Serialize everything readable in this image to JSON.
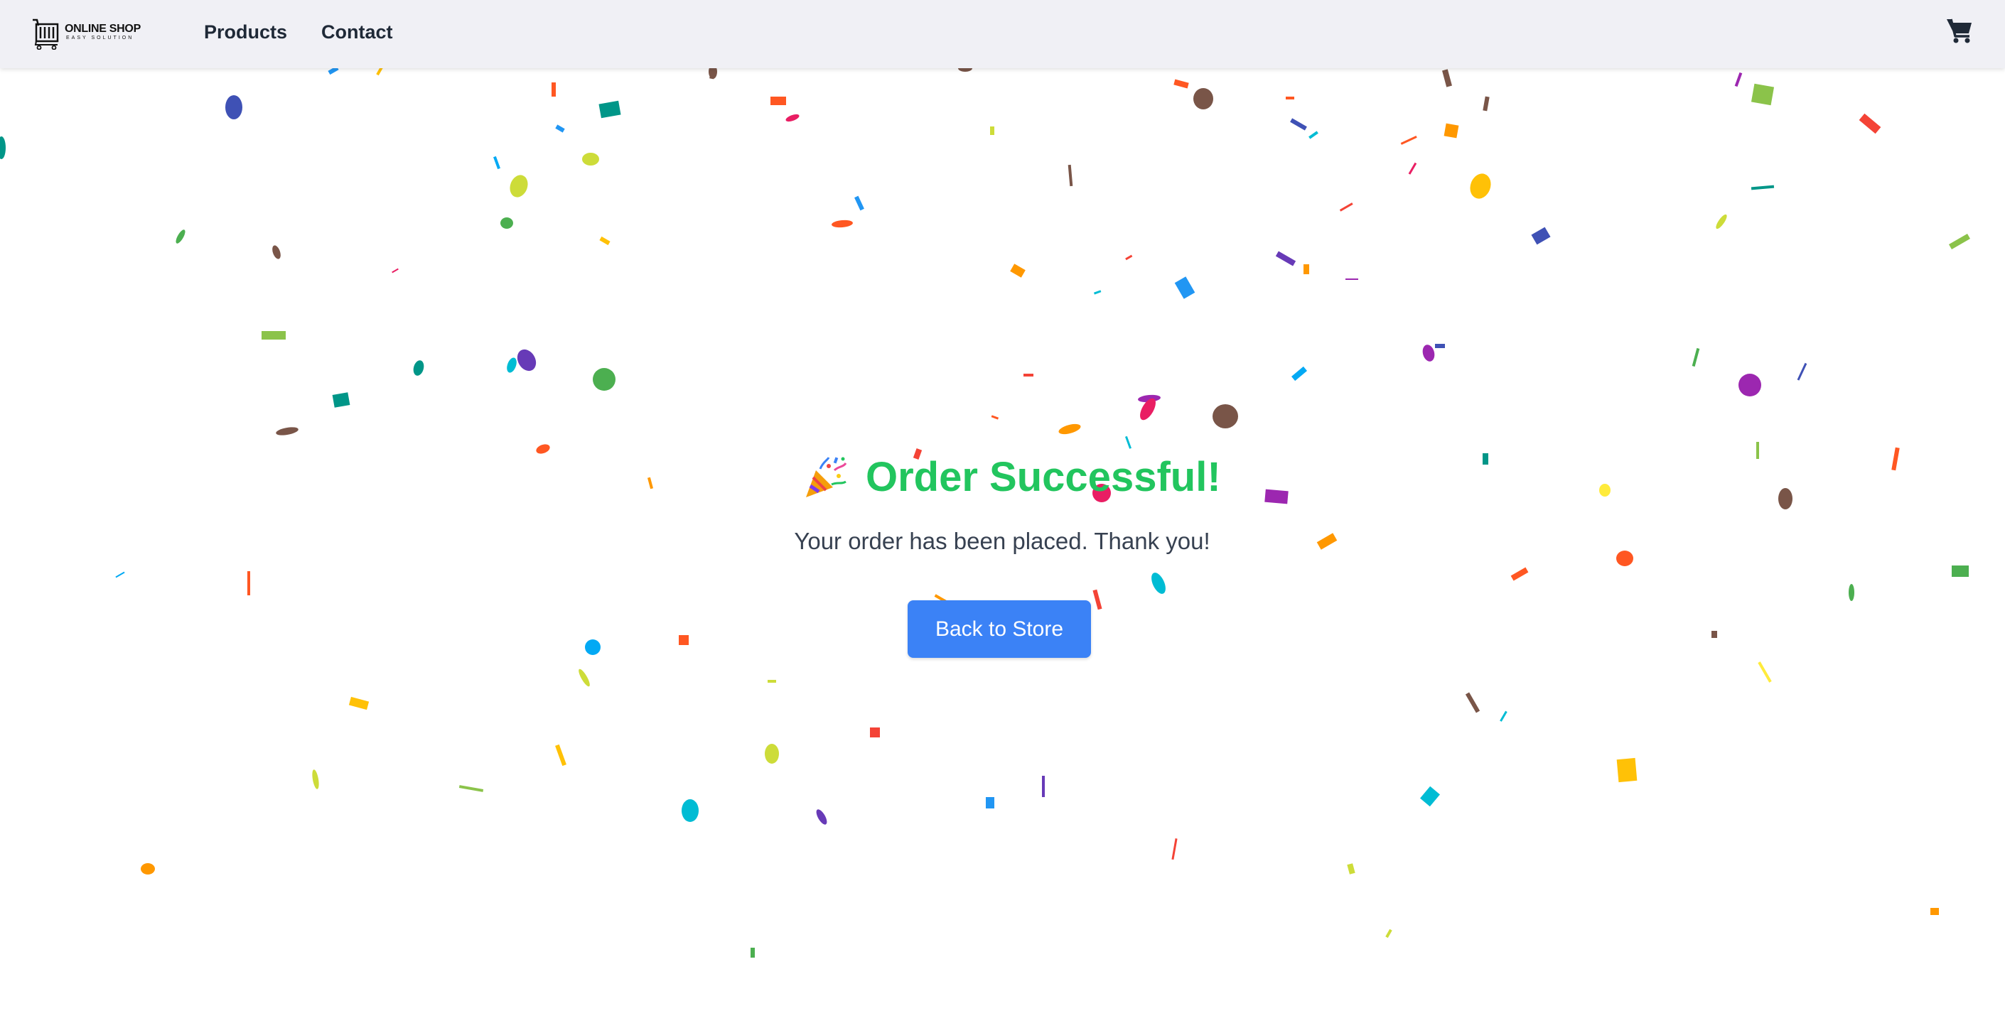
{
  "brand": {
    "logo_title": "ONLINE SHOP",
    "logo_subtitle": "EASY SOLUTION"
  },
  "nav": {
    "items": [
      {
        "label": "Products"
      },
      {
        "label": "Contact"
      }
    ],
    "cart_icon": "shopping-cart-icon"
  },
  "main": {
    "title_icon": "party-popper-icon",
    "title": "Order Successful!",
    "message": "Your order has been placed. Thank you!",
    "back_button": "Back to Store"
  },
  "colors": {
    "navbar_bg": "#f0f0f5",
    "title_green": "#22c55e",
    "button_blue": "#3b82f6",
    "confetti": [
      "#f44336",
      "#e91e63",
      "#9c27b0",
      "#673ab7",
      "#3f51b5",
      "#2196f3",
      "#03a9f4",
      "#00bcd4",
      "#009688",
      "#4caf50",
      "#8bc34a",
      "#cddc39",
      "#ffeb3b",
      "#ffc107",
      "#ff9800",
      "#ff5722",
      "#795548"
    ]
  }
}
